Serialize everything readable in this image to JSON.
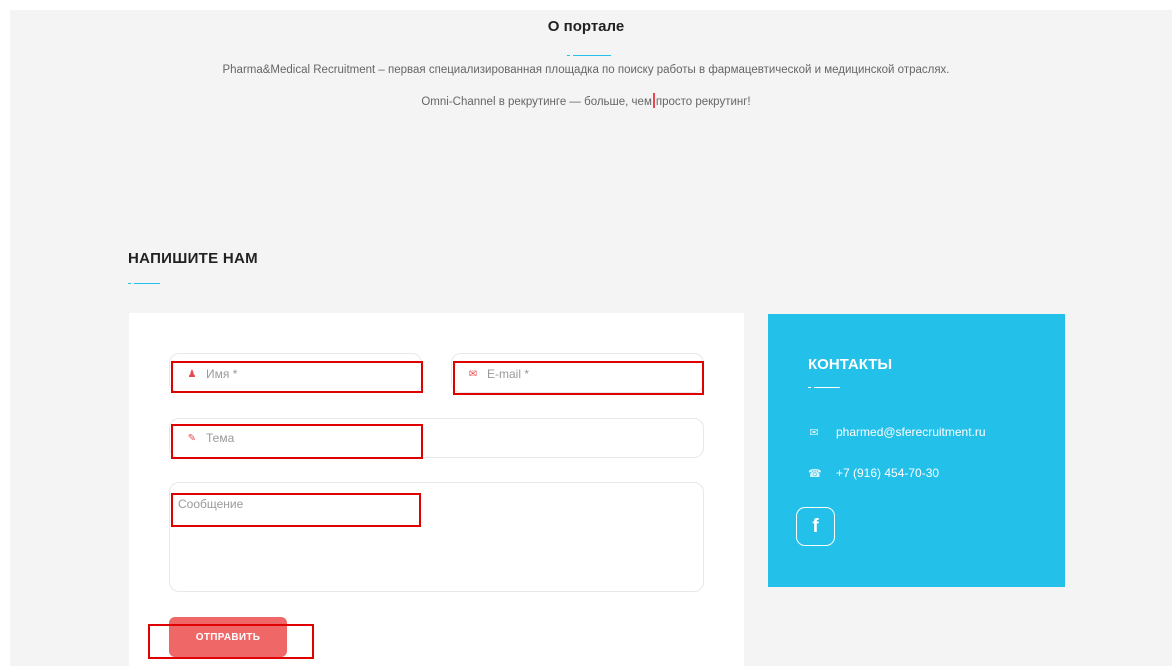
{
  "about": {
    "title": "О портале",
    "line1": "Pharma&Medical Recruitment – первая специализированная площадка по поиску работы в фармацевтической и медицинской отраслях.",
    "line2_part1": "Omni-Channel в рекрутинге — больше, чем",
    "line2_part2": "просто рекрутинг!"
  },
  "contact_form": {
    "title": "НАПИШИТЕ НАМ",
    "name_placeholder": "Имя *",
    "email_placeholder": "E-mail *",
    "subject_placeholder": "Тема",
    "message_placeholder": "Сообщение",
    "submit_label": "ОТПРАВИТЬ",
    "icons": {
      "name": "user-icon",
      "email": "envelope-icon",
      "subject": "edit-icon"
    }
  },
  "contacts": {
    "title": "КОНТАКТЫ",
    "email": "pharmed@sferecruitment.ru",
    "phone": "+7 (916) 454-70-30",
    "social": "facebook-icon"
  },
  "colors": {
    "accent": "#23c0e9",
    "button": "#f06767",
    "highlight": "#e00000",
    "background": "#f4f4f4"
  }
}
